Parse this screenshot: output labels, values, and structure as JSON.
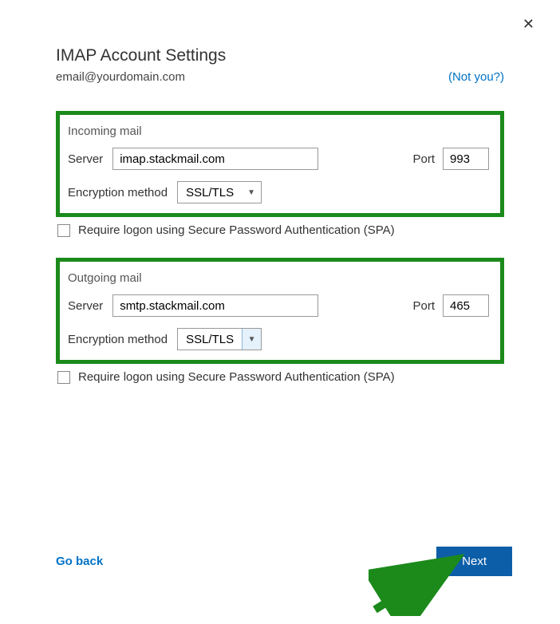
{
  "close_icon": "✕",
  "title": "IMAP Account Settings",
  "email": "email@yourdomain.com",
  "not_you": "(Not you?)",
  "incoming": {
    "section_label": "Incoming mail",
    "server_label": "Server",
    "server_value": "imap.stackmail.com",
    "port_label": "Port",
    "port_value": "993",
    "encryption_label": "Encryption method",
    "encryption_value": "SSL/TLS",
    "spa_label": "Require logon using Secure Password Authentication (SPA)"
  },
  "outgoing": {
    "section_label": "Outgoing mail",
    "server_label": "Server",
    "server_value": "smtp.stackmail.com",
    "port_label": "Port",
    "port_value": "465",
    "encryption_label": "Encryption method",
    "encryption_value": "SSL/TLS",
    "spa_label": "Require logon using Secure Password Authentication (SPA)"
  },
  "footer": {
    "go_back": "Go back",
    "next": "Next"
  }
}
